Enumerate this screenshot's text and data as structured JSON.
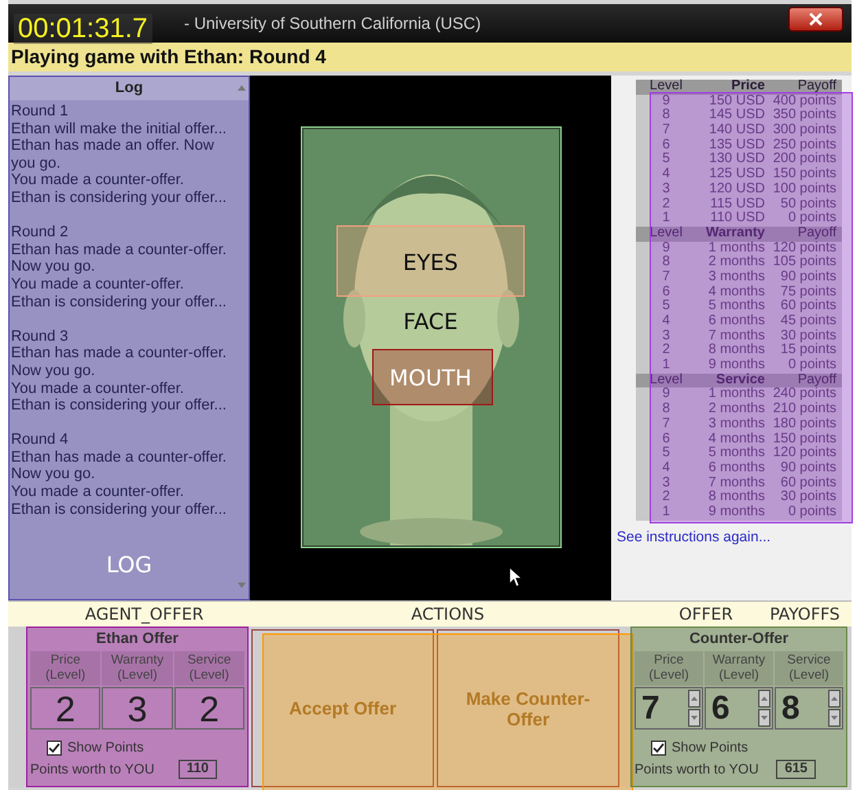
{
  "timer": "00:01:31.7",
  "window": {
    "title": "- University of Southern California (USC)"
  },
  "header": "Playing game with Ethan: Round 4",
  "log": {
    "title": "Log",
    "annotation": {
      "label": "LOG",
      "color": "#5b4fb0"
    },
    "rounds": [
      {
        "title": "Round 1",
        "lines": [
          "Ethan will make the initial offer...",
          "Ethan has made an offer. Now you go.",
          "You made a counter-offer.",
          "Ethan is considering your offer..."
        ]
      },
      {
        "title": "Round 2",
        "lines": [
          "Ethan has made a counter-offer. Now you go.",
          "You made a counter-offer.",
          "Ethan is considering your offer..."
        ]
      },
      {
        "title": "Round 3",
        "lines": [
          "Ethan has made a counter-offer. Now you go.",
          "You made a counter-offer.",
          "Ethan is considering your offer..."
        ]
      },
      {
        "title": "Round 4",
        "lines": [
          "Ethan has made a counter-offer. Now you go.",
          "You made a counter-offer.",
          "Ethan is considering your offer..."
        ]
      }
    ]
  },
  "face": {
    "kind": "picture",
    "annotation": {
      "label": "FACE",
      "color": "#8fcf8f"
    },
    "parts": [
      {
        "label": "EYES",
        "kind": "eyes",
        "color": "#f4a080"
      },
      {
        "label": "MOUTH",
        "kind": "mouth",
        "color": "#a01818"
      }
    ]
  },
  "payoffs": {
    "annotation": {
      "label": "PAYOFFS",
      "color": "#a040e0"
    },
    "sections": [
      {
        "columns": [
          "Level",
          "Price",
          "Payoff"
        ],
        "rows": [
          [
            "9",
            "150 USD",
            "400 points"
          ],
          [
            "8",
            "145 USD",
            "350 points"
          ],
          [
            "7",
            "140 USD",
            "300 points"
          ],
          [
            "6",
            "135 USD",
            "250 points"
          ],
          [
            "5",
            "130 USD",
            "200 points"
          ],
          [
            "4",
            "125 USD",
            "150 points"
          ],
          [
            "3",
            "120 USD",
            "100 points"
          ],
          [
            "2",
            "115 USD",
            "50 points"
          ],
          [
            "1",
            "110 USD",
            "0 points"
          ]
        ]
      },
      {
        "columns": [
          "Level",
          "Warranty",
          "Payoff"
        ],
        "rows": [
          [
            "9",
            "1 months",
            "120 points"
          ],
          [
            "8",
            "2 months",
            "105 points"
          ],
          [
            "7",
            "3 months",
            "90 points"
          ],
          [
            "6",
            "4 months",
            "75 points"
          ],
          [
            "5",
            "5 months",
            "60 points"
          ],
          [
            "4",
            "6 months",
            "45 points"
          ],
          [
            "3",
            "7 months",
            "30 points"
          ],
          [
            "2",
            "8 months",
            "15 points"
          ],
          [
            "1",
            "9 months",
            "0 points"
          ]
        ]
      },
      {
        "columns": [
          "Level",
          "Service",
          "Payoff"
        ],
        "rows": [
          [
            "9",
            "1 months",
            "240 points"
          ],
          [
            "8",
            "2 months",
            "210 points"
          ],
          [
            "7",
            "3 months",
            "180 points"
          ],
          [
            "6",
            "4 months",
            "150 points"
          ],
          [
            "5",
            "5 months",
            "120 points"
          ],
          [
            "4",
            "6 months",
            "90 points"
          ],
          [
            "3",
            "7 months",
            "60 points"
          ],
          [
            "2",
            "8 months",
            "30 points"
          ],
          [
            "1",
            "9 months",
            "0 points"
          ]
        ]
      }
    ],
    "link": "See instructions again..."
  },
  "agent_offer": {
    "title": "Ethan Offer",
    "annotation": {
      "label": "AGENT_OFFER",
      "color": "#a020a0"
    },
    "fields": [
      {
        "label": "Price\n(Level)",
        "value": "2"
      },
      {
        "label": "Warranty\n(Level)",
        "value": "3"
      },
      {
        "label": "Service\n(Level)",
        "value": "2"
      }
    ],
    "show_points": {
      "label": "Show Points",
      "checked": true
    },
    "points_label": "Points worth to YOU",
    "points": "110"
  },
  "actions": {
    "annotation": {
      "label": "ACTIONS",
      "color": "#ff9900"
    },
    "buttons": [
      "Accept Offer",
      "Make Counter-Offer"
    ]
  },
  "counter_offer": {
    "title": "Counter-Offer",
    "annotation": {
      "label": "OFFER",
      "color": "#6a8a4a"
    },
    "fields": [
      {
        "label": "Price\n(Level)",
        "value": "7"
      },
      {
        "label": "Warranty\n(Level)",
        "value": "6"
      },
      {
        "label": "Service\n(Level)",
        "value": "8"
      }
    ],
    "show_points": {
      "label": "Show Points",
      "checked": true
    },
    "points_label": "Points worth to YOU",
    "points": "615"
  }
}
